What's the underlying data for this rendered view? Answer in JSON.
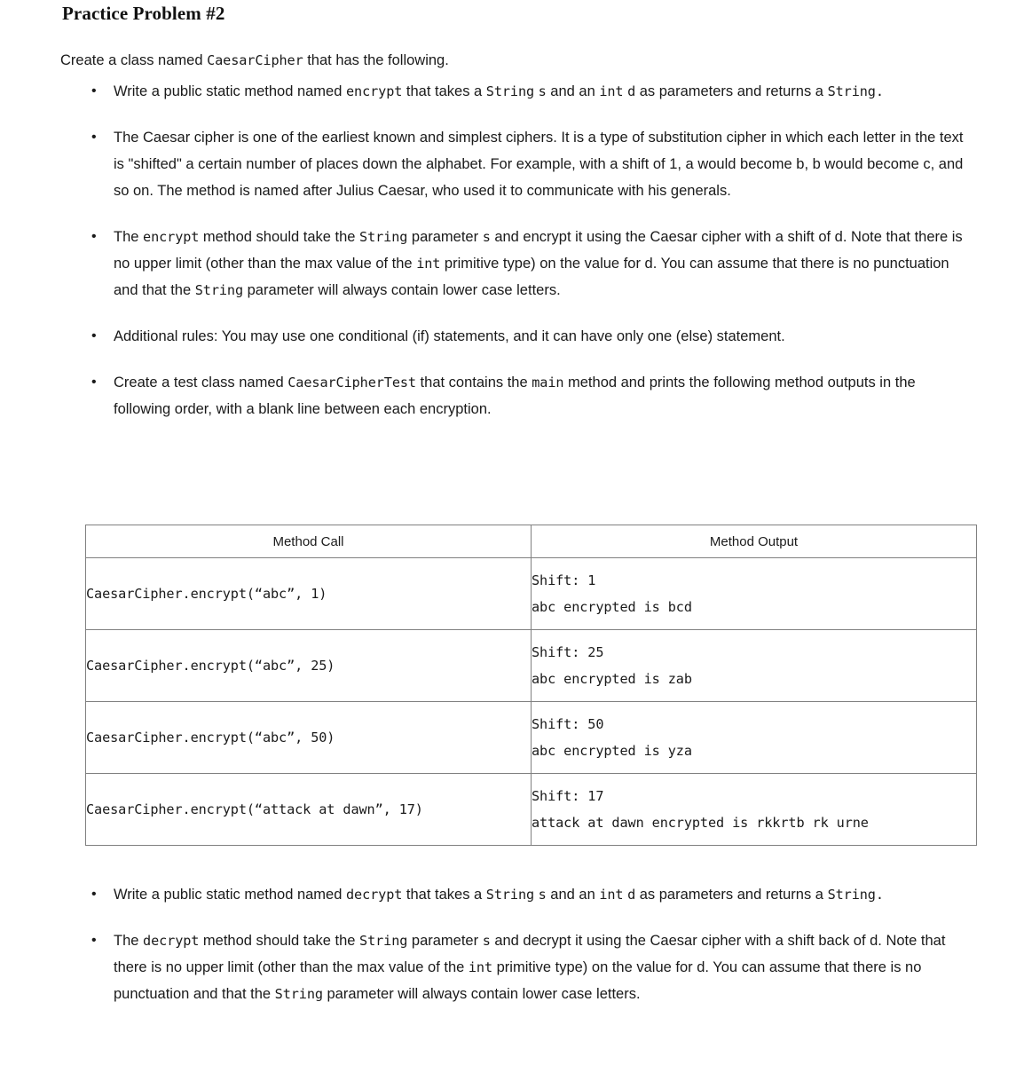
{
  "title": "Practice Problem #2",
  "intro": {
    "before": "Create a class named ",
    "code": "CaesarCipher",
    "after": " that has the following."
  },
  "bullets_before_table": [
    {
      "id": "encrypt-signature",
      "parts": [
        {
          "t": "text",
          "v": "Write a public static method named "
        },
        {
          "t": "code",
          "v": "encrypt"
        },
        {
          "t": "text",
          "v": " that takes a "
        },
        {
          "t": "code",
          "v": "String"
        },
        {
          "t": "text",
          "v": " "
        },
        {
          "t": "code",
          "v": "s"
        },
        {
          "t": "text",
          "v": " and an "
        },
        {
          "t": "code",
          "v": "int"
        },
        {
          "t": "text",
          "v": " "
        },
        {
          "t": "code",
          "v": "d"
        },
        {
          "t": "text",
          "v": " as parameters and returns a "
        },
        {
          "t": "code",
          "v": "String."
        }
      ]
    },
    {
      "id": "caesar-background",
      "parts": [
        {
          "t": "text",
          "v": "The Caesar cipher is one of the earliest known and simplest ciphers. It is a type of substitution cipher in which each letter in the text is \"shifted\" a certain number of places down the alphabet. For example, with a shift of 1, a would become b, b would become c, and so on. The method is named after Julius Caesar, who used it to communicate with his generals."
        }
      ]
    },
    {
      "id": "encrypt-behavior",
      "parts": [
        {
          "t": "text",
          "v": "The "
        },
        {
          "t": "code",
          "v": "encrypt"
        },
        {
          "t": "text",
          "v": " method should take the "
        },
        {
          "t": "code",
          "v": "String"
        },
        {
          "t": "text",
          "v": " parameter "
        },
        {
          "t": "code",
          "v": "s"
        },
        {
          "t": "text",
          "v": " and encrypt it using the Caesar cipher with a shift of d. Note that there is no upper limit (other than the max value of the "
        },
        {
          "t": "code",
          "v": "int"
        },
        {
          "t": "text",
          "v": " primitive type) on the value for d. You can assume that there is no punctuation and that the "
        },
        {
          "t": "code",
          "v": "String"
        },
        {
          "t": "text",
          "v": " parameter will always contain lower case letters."
        }
      ]
    },
    {
      "id": "additional-rules",
      "parts": [
        {
          "t": "text",
          "v": "Additional rules: You may use one conditional (if) statements, and it can have only one (else) statement."
        }
      ]
    },
    {
      "id": "test-class",
      "parts": [
        {
          "t": "text",
          "v": "Create a test class named "
        },
        {
          "t": "code",
          "v": "CaesarCipherTest"
        },
        {
          "t": "text",
          "v": " that contains the "
        },
        {
          "t": "code",
          "v": "main"
        },
        {
          "t": "text",
          "v": " method and prints the following method outputs in the following order, with a blank line between each encryption."
        }
      ]
    }
  ],
  "table": {
    "headers": [
      "Method Call",
      "Method Output"
    ],
    "rows": [
      {
        "call": "CaesarCipher.encrypt(“abc”, 1)",
        "out_line1": "Shift: 1",
        "out_line2": "abc encrypted is bcd"
      },
      {
        "call": "CaesarCipher.encrypt(“abc”, 25)",
        "out_line1": "Shift: 25",
        "out_line2": "abc encrypted is zab"
      },
      {
        "call": "CaesarCipher.encrypt(“abc”, 50)",
        "out_line1": "Shift: 50",
        "out_line2": "abc encrypted is yza"
      },
      {
        "call": "CaesarCipher.encrypt(“attack at dawn”, 17)",
        "out_line1": "Shift: 17",
        "out_line2": "attack at dawn encrypted is rkkrtb rk urne"
      }
    ]
  },
  "bullets_after_table": [
    {
      "id": "decrypt-signature",
      "parts": [
        {
          "t": "text",
          "v": "Write a public static method named "
        },
        {
          "t": "code",
          "v": "decrypt"
        },
        {
          "t": "text",
          "v": " that takes a "
        },
        {
          "t": "code",
          "v": "String"
        },
        {
          "t": "text",
          "v": " "
        },
        {
          "t": "code",
          "v": "s"
        },
        {
          "t": "text",
          "v": " and an "
        },
        {
          "t": "code",
          "v": "int"
        },
        {
          "t": "text",
          "v": " "
        },
        {
          "t": "code",
          "v": "d"
        },
        {
          "t": "text",
          "v": " as parameters and returns a "
        },
        {
          "t": "code",
          "v": "String."
        }
      ]
    },
    {
      "id": "decrypt-behavior",
      "parts": [
        {
          "t": "text",
          "v": "The "
        },
        {
          "t": "code",
          "v": "decrypt"
        },
        {
          "t": "text",
          "v": " method should take the "
        },
        {
          "t": "code",
          "v": "String"
        },
        {
          "t": "text",
          "v": " parameter "
        },
        {
          "t": "code",
          "v": "s"
        },
        {
          "t": "text",
          "v": " and decrypt it using the Caesar cipher with a shift back of d. Note that there is no upper limit (other than the max value of the "
        },
        {
          "t": "code",
          "v": "int"
        },
        {
          "t": "text",
          "v": " primitive type) on the value for d. You can assume that there is no punctuation and that the "
        },
        {
          "t": "code",
          "v": "String"
        },
        {
          "t": "text",
          "v": " parameter will always contain lower case letters."
        }
      ]
    }
  ],
  "bullet_glyph": "•"
}
